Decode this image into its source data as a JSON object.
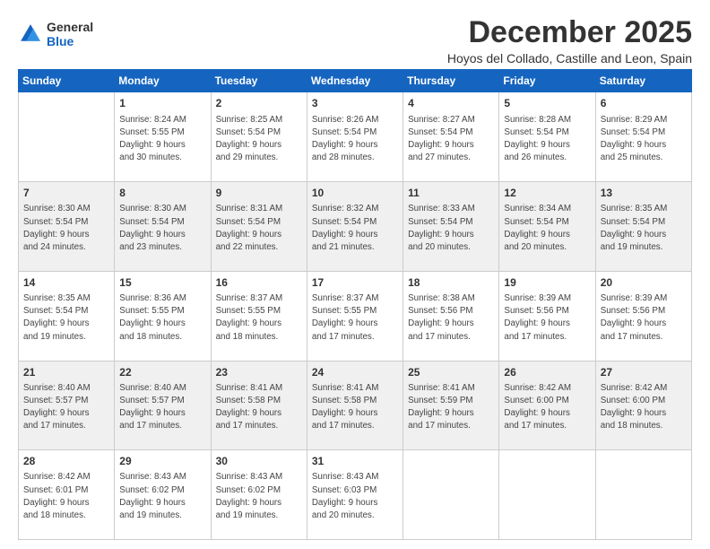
{
  "logo": {
    "line1": "General",
    "line2": "Blue"
  },
  "title": "December 2025",
  "subtitle": "Hoyos del Collado, Castille and Leon, Spain",
  "weekdays": [
    "Sunday",
    "Monday",
    "Tuesday",
    "Wednesday",
    "Thursday",
    "Friday",
    "Saturday"
  ],
  "weeks": [
    [
      {
        "day": "",
        "text": ""
      },
      {
        "day": "1",
        "text": "Sunrise: 8:24 AM\nSunset: 5:55 PM\nDaylight: 9 hours\nand 30 minutes."
      },
      {
        "day": "2",
        "text": "Sunrise: 8:25 AM\nSunset: 5:54 PM\nDaylight: 9 hours\nand 29 minutes."
      },
      {
        "day": "3",
        "text": "Sunrise: 8:26 AM\nSunset: 5:54 PM\nDaylight: 9 hours\nand 28 minutes."
      },
      {
        "day": "4",
        "text": "Sunrise: 8:27 AM\nSunset: 5:54 PM\nDaylight: 9 hours\nand 27 minutes."
      },
      {
        "day": "5",
        "text": "Sunrise: 8:28 AM\nSunset: 5:54 PM\nDaylight: 9 hours\nand 26 minutes."
      },
      {
        "day": "6",
        "text": "Sunrise: 8:29 AM\nSunset: 5:54 PM\nDaylight: 9 hours\nand 25 minutes."
      }
    ],
    [
      {
        "day": "7",
        "text": "Sunrise: 8:30 AM\nSunset: 5:54 PM\nDaylight: 9 hours\nand 24 minutes."
      },
      {
        "day": "8",
        "text": "Sunrise: 8:30 AM\nSunset: 5:54 PM\nDaylight: 9 hours\nand 23 minutes."
      },
      {
        "day": "9",
        "text": "Sunrise: 8:31 AM\nSunset: 5:54 PM\nDaylight: 9 hours\nand 22 minutes."
      },
      {
        "day": "10",
        "text": "Sunrise: 8:32 AM\nSunset: 5:54 PM\nDaylight: 9 hours\nand 21 minutes."
      },
      {
        "day": "11",
        "text": "Sunrise: 8:33 AM\nSunset: 5:54 PM\nDaylight: 9 hours\nand 20 minutes."
      },
      {
        "day": "12",
        "text": "Sunrise: 8:34 AM\nSunset: 5:54 PM\nDaylight: 9 hours\nand 20 minutes."
      },
      {
        "day": "13",
        "text": "Sunrise: 8:35 AM\nSunset: 5:54 PM\nDaylight: 9 hours\nand 19 minutes."
      }
    ],
    [
      {
        "day": "14",
        "text": "Sunrise: 8:35 AM\nSunset: 5:54 PM\nDaylight: 9 hours\nand 19 minutes."
      },
      {
        "day": "15",
        "text": "Sunrise: 8:36 AM\nSunset: 5:55 PM\nDaylight: 9 hours\nand 18 minutes."
      },
      {
        "day": "16",
        "text": "Sunrise: 8:37 AM\nSunset: 5:55 PM\nDaylight: 9 hours\nand 18 minutes."
      },
      {
        "day": "17",
        "text": "Sunrise: 8:37 AM\nSunset: 5:55 PM\nDaylight: 9 hours\nand 17 minutes."
      },
      {
        "day": "18",
        "text": "Sunrise: 8:38 AM\nSunset: 5:56 PM\nDaylight: 9 hours\nand 17 minutes."
      },
      {
        "day": "19",
        "text": "Sunrise: 8:39 AM\nSunset: 5:56 PM\nDaylight: 9 hours\nand 17 minutes."
      },
      {
        "day": "20",
        "text": "Sunrise: 8:39 AM\nSunset: 5:56 PM\nDaylight: 9 hours\nand 17 minutes."
      }
    ],
    [
      {
        "day": "21",
        "text": "Sunrise: 8:40 AM\nSunset: 5:57 PM\nDaylight: 9 hours\nand 17 minutes."
      },
      {
        "day": "22",
        "text": "Sunrise: 8:40 AM\nSunset: 5:57 PM\nDaylight: 9 hours\nand 17 minutes."
      },
      {
        "day": "23",
        "text": "Sunrise: 8:41 AM\nSunset: 5:58 PM\nDaylight: 9 hours\nand 17 minutes."
      },
      {
        "day": "24",
        "text": "Sunrise: 8:41 AM\nSunset: 5:58 PM\nDaylight: 9 hours\nand 17 minutes."
      },
      {
        "day": "25",
        "text": "Sunrise: 8:41 AM\nSunset: 5:59 PM\nDaylight: 9 hours\nand 17 minutes."
      },
      {
        "day": "26",
        "text": "Sunrise: 8:42 AM\nSunset: 6:00 PM\nDaylight: 9 hours\nand 17 minutes."
      },
      {
        "day": "27",
        "text": "Sunrise: 8:42 AM\nSunset: 6:00 PM\nDaylight: 9 hours\nand 18 minutes."
      }
    ],
    [
      {
        "day": "28",
        "text": "Sunrise: 8:42 AM\nSunset: 6:01 PM\nDaylight: 9 hours\nand 18 minutes."
      },
      {
        "day": "29",
        "text": "Sunrise: 8:43 AM\nSunset: 6:02 PM\nDaylight: 9 hours\nand 19 minutes."
      },
      {
        "day": "30",
        "text": "Sunrise: 8:43 AM\nSunset: 6:02 PM\nDaylight: 9 hours\nand 19 minutes."
      },
      {
        "day": "31",
        "text": "Sunrise: 8:43 AM\nSunset: 6:03 PM\nDaylight: 9 hours\nand 20 minutes."
      },
      {
        "day": "",
        "text": ""
      },
      {
        "day": "",
        "text": ""
      },
      {
        "day": "",
        "text": ""
      }
    ]
  ]
}
